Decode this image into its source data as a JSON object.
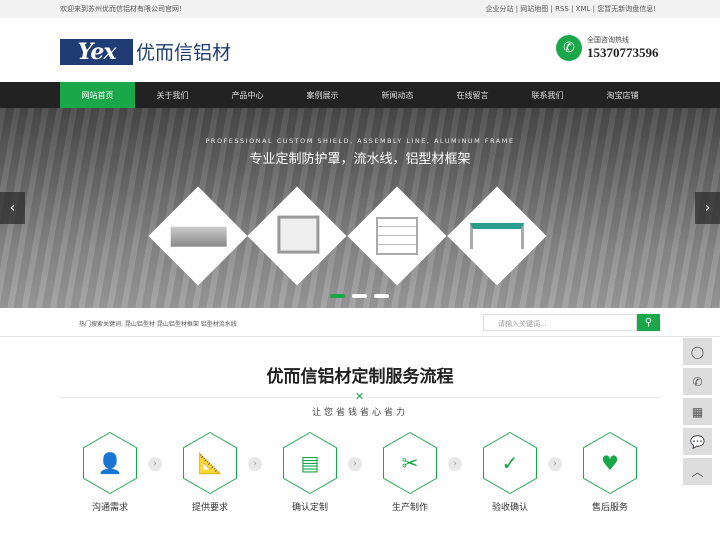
{
  "topbar": {
    "welcome": "欢迎来到苏州优而信铝材有限公司官网!",
    "links": "企业分站 | 网站地图 | RSS | XML | 您暂无新询盘信息!"
  },
  "header": {
    "logo_mark": "Yex",
    "logo_text": "优而信铝材",
    "hotline_label": "全国咨询热线",
    "hotline": "15370773596"
  },
  "nav": [
    "网站首页",
    "关于我们",
    "产品中心",
    "案例展示",
    "新闻动态",
    "在线留言",
    "联系我们",
    "淘宝店铺"
  ],
  "banner": {
    "en": "PROFESSIONAL CUSTOM SHIELD, ASSEMBLY LINE, ALUMINUM FRAME",
    "cn": "专业定制防护罩，流水线，铝型材框架",
    "slides": 3,
    "active_slide": 1
  },
  "search": {
    "keywords": "热门搜索关键词:  昆山铝型材   昆山铝型材框架   铝型材流水线",
    "placeholder": "请输入关键词..."
  },
  "section": {
    "title": "优而信铝材定制服务流程",
    "subtitle": "让您省钱省心省力"
  },
  "steps": [
    {
      "label": "沟通需求",
      "icon": "chat-user-icon"
    },
    {
      "label": "提供要求",
      "icon": "ruler-pen-icon"
    },
    {
      "label": "确认定制",
      "icon": "blueprint-icon"
    },
    {
      "label": "生产制作",
      "icon": "tools-icon"
    },
    {
      "label": "验收确认",
      "icon": "document-check-icon"
    },
    {
      "label": "售后服务",
      "icon": "handshake-icon"
    }
  ],
  "colors": {
    "accent": "#1aa74a",
    "nav_bg": "#222222",
    "logo": "#1f3c74"
  }
}
